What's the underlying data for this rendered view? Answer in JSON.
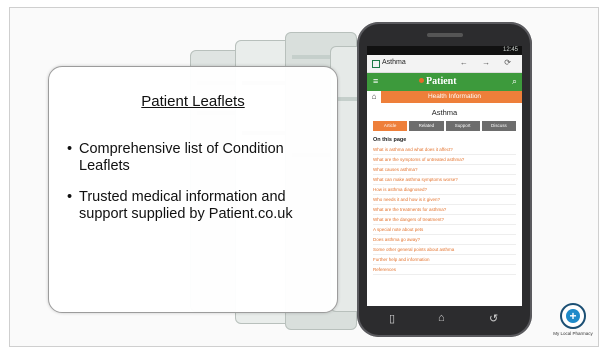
{
  "card": {
    "title": "Patient Leaflets",
    "bullets": [
      "Comprehensive list of Condition Leaflets",
      "Trusted medical information and support supplied by Patient.co.uk"
    ]
  },
  "phone": {
    "status_time": "12:45",
    "url_text": "Asthma",
    "nav_arrows": "← → ⟳",
    "menu_icon": "menu-icon",
    "logo_text": "Patient",
    "search_icon": "search-icon",
    "home_icon": "home-icon",
    "crumb_text": "Health Information",
    "topic_title": "Asthma",
    "tabs": [
      "Article",
      "Related",
      "Support",
      "Discuss"
    ],
    "on_page_heading": "On this page",
    "links": [
      "What is asthma and what does it affect?",
      "What are the symptoms of untreated asthma?",
      "What causes asthma?",
      "What can make asthma symptoms worse?",
      "How is asthma diagnosed?",
      "Who needs it and how is it given?",
      "What are the treatments for asthma?",
      "What are the dangers of treatment?",
      "A special note about pets",
      "Does asthma go away?",
      "Some other general points about asthma",
      "Further help and information",
      "References"
    ],
    "nav": {
      "back": "▯",
      "home": "⌂",
      "recent": "↺"
    }
  },
  "brand": {
    "name": "My Local Pharmacy",
    "logo_icon": "plus-circle-icon",
    "colors": {
      "green": "#3d9a3c",
      "orange": "#ee7f3a",
      "blue": "#1e8ac9"
    }
  }
}
